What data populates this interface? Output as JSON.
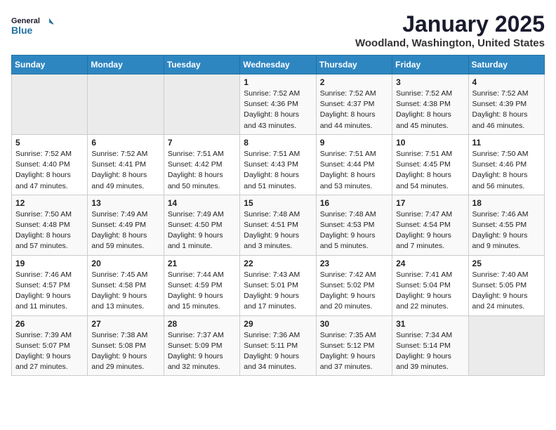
{
  "header": {
    "logo_line1": "General",
    "logo_line2": "Blue",
    "title": "January 2025",
    "location": "Woodland, Washington, United States"
  },
  "days_of_week": [
    "Sunday",
    "Monday",
    "Tuesday",
    "Wednesday",
    "Thursday",
    "Friday",
    "Saturday"
  ],
  "weeks": [
    [
      {
        "day": "",
        "info": ""
      },
      {
        "day": "",
        "info": ""
      },
      {
        "day": "",
        "info": ""
      },
      {
        "day": "1",
        "info": "Sunrise: 7:52 AM\nSunset: 4:36 PM\nDaylight: 8 hours\nand 43 minutes."
      },
      {
        "day": "2",
        "info": "Sunrise: 7:52 AM\nSunset: 4:37 PM\nDaylight: 8 hours\nand 44 minutes."
      },
      {
        "day": "3",
        "info": "Sunrise: 7:52 AM\nSunset: 4:38 PM\nDaylight: 8 hours\nand 45 minutes."
      },
      {
        "day": "4",
        "info": "Sunrise: 7:52 AM\nSunset: 4:39 PM\nDaylight: 8 hours\nand 46 minutes."
      }
    ],
    [
      {
        "day": "5",
        "info": "Sunrise: 7:52 AM\nSunset: 4:40 PM\nDaylight: 8 hours\nand 47 minutes."
      },
      {
        "day": "6",
        "info": "Sunrise: 7:52 AM\nSunset: 4:41 PM\nDaylight: 8 hours\nand 49 minutes."
      },
      {
        "day": "7",
        "info": "Sunrise: 7:51 AM\nSunset: 4:42 PM\nDaylight: 8 hours\nand 50 minutes."
      },
      {
        "day": "8",
        "info": "Sunrise: 7:51 AM\nSunset: 4:43 PM\nDaylight: 8 hours\nand 51 minutes."
      },
      {
        "day": "9",
        "info": "Sunrise: 7:51 AM\nSunset: 4:44 PM\nDaylight: 8 hours\nand 53 minutes."
      },
      {
        "day": "10",
        "info": "Sunrise: 7:51 AM\nSunset: 4:45 PM\nDaylight: 8 hours\nand 54 minutes."
      },
      {
        "day": "11",
        "info": "Sunrise: 7:50 AM\nSunset: 4:46 PM\nDaylight: 8 hours\nand 56 minutes."
      }
    ],
    [
      {
        "day": "12",
        "info": "Sunrise: 7:50 AM\nSunset: 4:48 PM\nDaylight: 8 hours\nand 57 minutes."
      },
      {
        "day": "13",
        "info": "Sunrise: 7:49 AM\nSunset: 4:49 PM\nDaylight: 8 hours\nand 59 minutes."
      },
      {
        "day": "14",
        "info": "Sunrise: 7:49 AM\nSunset: 4:50 PM\nDaylight: 9 hours\nand 1 minute."
      },
      {
        "day": "15",
        "info": "Sunrise: 7:48 AM\nSunset: 4:51 PM\nDaylight: 9 hours\nand 3 minutes."
      },
      {
        "day": "16",
        "info": "Sunrise: 7:48 AM\nSunset: 4:53 PM\nDaylight: 9 hours\nand 5 minutes."
      },
      {
        "day": "17",
        "info": "Sunrise: 7:47 AM\nSunset: 4:54 PM\nDaylight: 9 hours\nand 7 minutes."
      },
      {
        "day": "18",
        "info": "Sunrise: 7:46 AM\nSunset: 4:55 PM\nDaylight: 9 hours\nand 9 minutes."
      }
    ],
    [
      {
        "day": "19",
        "info": "Sunrise: 7:46 AM\nSunset: 4:57 PM\nDaylight: 9 hours\nand 11 minutes."
      },
      {
        "day": "20",
        "info": "Sunrise: 7:45 AM\nSunset: 4:58 PM\nDaylight: 9 hours\nand 13 minutes."
      },
      {
        "day": "21",
        "info": "Sunrise: 7:44 AM\nSunset: 4:59 PM\nDaylight: 9 hours\nand 15 minutes."
      },
      {
        "day": "22",
        "info": "Sunrise: 7:43 AM\nSunset: 5:01 PM\nDaylight: 9 hours\nand 17 minutes."
      },
      {
        "day": "23",
        "info": "Sunrise: 7:42 AM\nSunset: 5:02 PM\nDaylight: 9 hours\nand 20 minutes."
      },
      {
        "day": "24",
        "info": "Sunrise: 7:41 AM\nSunset: 5:04 PM\nDaylight: 9 hours\nand 22 minutes."
      },
      {
        "day": "25",
        "info": "Sunrise: 7:40 AM\nSunset: 5:05 PM\nDaylight: 9 hours\nand 24 minutes."
      }
    ],
    [
      {
        "day": "26",
        "info": "Sunrise: 7:39 AM\nSunset: 5:07 PM\nDaylight: 9 hours\nand 27 minutes."
      },
      {
        "day": "27",
        "info": "Sunrise: 7:38 AM\nSunset: 5:08 PM\nDaylight: 9 hours\nand 29 minutes."
      },
      {
        "day": "28",
        "info": "Sunrise: 7:37 AM\nSunset: 5:09 PM\nDaylight: 9 hours\nand 32 minutes."
      },
      {
        "day": "29",
        "info": "Sunrise: 7:36 AM\nSunset: 5:11 PM\nDaylight: 9 hours\nand 34 minutes."
      },
      {
        "day": "30",
        "info": "Sunrise: 7:35 AM\nSunset: 5:12 PM\nDaylight: 9 hours\nand 37 minutes."
      },
      {
        "day": "31",
        "info": "Sunrise: 7:34 AM\nSunset: 5:14 PM\nDaylight: 9 hours\nand 39 minutes."
      },
      {
        "day": "",
        "info": ""
      }
    ]
  ]
}
